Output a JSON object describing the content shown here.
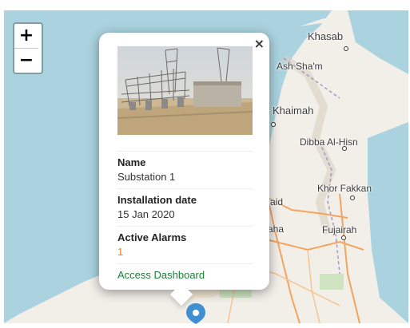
{
  "map": {
    "places": {
      "khasab": "Khasab",
      "ash_sham": "Ash Sha'm",
      "khaimah": "Khaimah",
      "dibba": "Dibba Al-Hisn",
      "khor_fakkan": "Khor Fakkan",
      "fujairah": "Fujairah",
      "aid": "aid",
      "aha": "aha"
    },
    "colors": {
      "sea": "#aad3df",
      "land": "#f2efe9",
      "desert": "#f1e6d2",
      "road": "#f4a460",
      "green": "#cfe5c2"
    }
  },
  "zoom": {
    "in_label": "+",
    "out_label": "−"
  },
  "popup": {
    "close_label": "×",
    "image_icon": "substation-photo",
    "fields": {
      "name_label": "Name",
      "name_value": "Substation 1",
      "date_label": "Installation date",
      "date_value": "15 Jan 2020",
      "alarms_label": "Active Alarms",
      "alarms_value": "1"
    },
    "link_label": "Access Dashboard"
  },
  "marker": {
    "icon": "location-pin-icon",
    "color": "#3f8fd2"
  }
}
